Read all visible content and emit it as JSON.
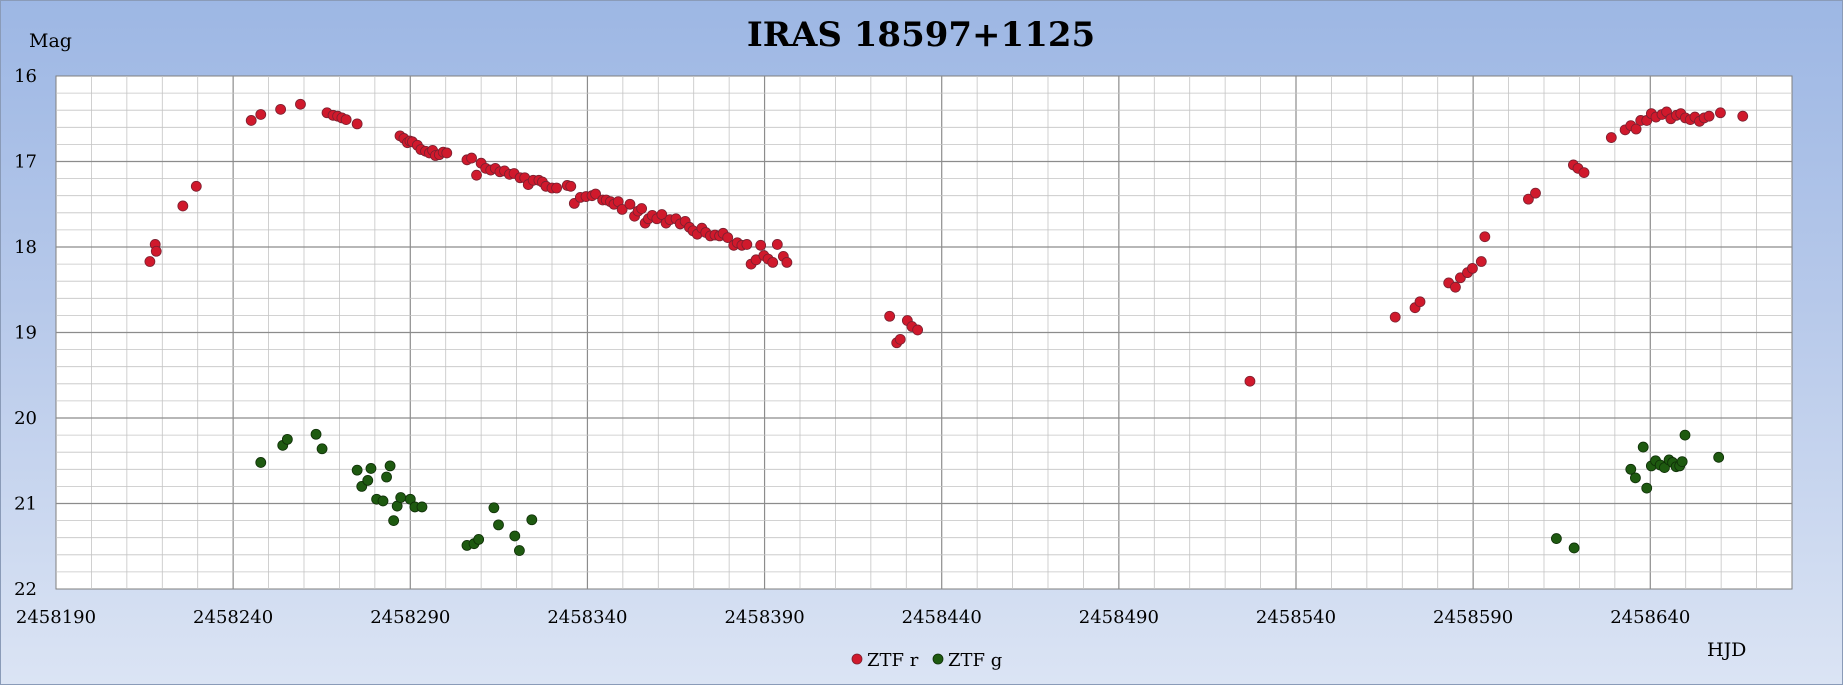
{
  "chart_data": {
    "type": "scatter",
    "title": "IRAS 18597+1125",
    "ylabel": "Mag",
    "xlabel": "HJD",
    "xlim": [
      2458190,
      2458680
    ],
    "ylim": [
      22,
      16
    ],
    "y_inverted": true,
    "x_ticks": [
      "2458190",
      "2458240",
      "2458290",
      "2458340",
      "2458390",
      "2458440",
      "2458490",
      "2458540",
      "2458590",
      "2458640"
    ],
    "x_tick_values": [
      2458190,
      2458240,
      2458290,
      2458340,
      2458390,
      2458440,
      2458490,
      2458540,
      2458590,
      2458640
    ],
    "y_ticks": [
      "16",
      "17",
      "18",
      "19",
      "20",
      "21",
      "22"
    ],
    "y_tick_values": [
      16,
      17,
      18,
      19,
      20,
      21,
      22
    ],
    "grid": true,
    "legend_position": "bottom-center",
    "series": [
      {
        "name": "ZTF r",
        "color": "#d0192c",
        "points": [
          [
            2458216.5,
            18.17
          ],
          [
            2458218.0,
            17.97
          ],
          [
            2458218.3,
            18.05
          ],
          [
            2458225.8,
            17.52
          ],
          [
            2458229.6,
            17.29
          ],
          [
            2458245.1,
            16.52
          ],
          [
            2458247.8,
            16.45
          ],
          [
            2458253.4,
            16.39
          ],
          [
            2458259.0,
            16.33
          ],
          [
            2458266.5,
            16.43
          ],
          [
            2458268.2,
            16.46
          ],
          [
            2458269.5,
            16.47
          ],
          [
            2458270.7,
            16.49
          ],
          [
            2458271.9,
            16.51
          ],
          [
            2458275.0,
            16.56
          ],
          [
            2458287.1,
            16.7
          ],
          [
            2458288.2,
            16.73
          ],
          [
            2458289.2,
            16.78
          ],
          [
            2458289.9,
            16.76
          ],
          [
            2458290.6,
            16.77
          ],
          [
            2458292.0,
            16.81
          ],
          [
            2458293.0,
            16.86
          ],
          [
            2458294.3,
            16.88
          ],
          [
            2458295.4,
            16.9
          ],
          [
            2458296.3,
            16.87
          ],
          [
            2458297.1,
            16.93
          ],
          [
            2458298.2,
            16.92
          ],
          [
            2458299.3,
            16.89
          ],
          [
            2458300.3,
            16.9
          ],
          [
            2458306.0,
            16.98
          ],
          [
            2458307.3,
            16.96
          ],
          [
            2458308.7,
            17.16
          ],
          [
            2458310.0,
            17.02
          ],
          [
            2458311.3,
            17.08
          ],
          [
            2458312.7,
            17.1
          ],
          [
            2458314.0,
            17.08
          ],
          [
            2458315.3,
            17.12
          ],
          [
            2458316.6,
            17.11
          ],
          [
            2458318.0,
            17.15
          ],
          [
            2458319.3,
            17.14
          ],
          [
            2458321.0,
            17.19
          ],
          [
            2458322.3,
            17.19
          ],
          [
            2458323.3,
            17.27
          ],
          [
            2458324.7,
            17.22
          ],
          [
            2458326.3,
            17.22
          ],
          [
            2458327.3,
            17.24
          ],
          [
            2458328.3,
            17.29
          ],
          [
            2458330.0,
            17.31
          ],
          [
            2458331.3,
            17.31
          ],
          [
            2458334.3,
            17.28
          ],
          [
            2458335.3,
            17.29
          ],
          [
            2458336.3,
            17.49
          ],
          [
            2458338.0,
            17.42
          ],
          [
            2458339.6,
            17.41
          ],
          [
            2458341.3,
            17.4
          ],
          [
            2458342.3,
            17.38
          ],
          [
            2458344.3,
            17.45
          ],
          [
            2458345.3,
            17.45
          ],
          [
            2458346.5,
            17.47
          ],
          [
            2458347.5,
            17.5
          ],
          [
            2458348.7,
            17.47
          ],
          [
            2458349.8,
            17.56
          ],
          [
            2458352.0,
            17.5
          ],
          [
            2458353.3,
            17.64
          ],
          [
            2458354.3,
            17.58
          ],
          [
            2458355.3,
            17.55
          ],
          [
            2458356.3,
            17.72
          ],
          [
            2458357.2,
            17.67
          ],
          [
            2458358.3,
            17.63
          ],
          [
            2458359.6,
            17.67
          ],
          [
            2458361.0,
            17.62
          ],
          [
            2458362.2,
            17.72
          ],
          [
            2458363.3,
            17.68
          ],
          [
            2458365.0,
            17.67
          ],
          [
            2458366.2,
            17.73
          ],
          [
            2458367.6,
            17.7
          ],
          [
            2458368.8,
            17.77
          ],
          [
            2458369.8,
            17.81
          ],
          [
            2458371.0,
            17.85
          ],
          [
            2458372.3,
            17.78
          ],
          [
            2458373.4,
            17.83
          ],
          [
            2458374.7,
            17.87
          ],
          [
            2458376.0,
            17.86
          ],
          [
            2458377.3,
            17.87
          ],
          [
            2458378.3,
            17.84
          ],
          [
            2458379.6,
            17.89
          ],
          [
            2458381.3,
            17.98
          ],
          [
            2458382.3,
            17.95
          ],
          [
            2458383.6,
            17.98
          ],
          [
            2458385.0,
            17.97
          ],
          [
            2458386.2,
            18.2
          ],
          [
            2458387.6,
            18.15
          ],
          [
            2458388.9,
            17.98
          ],
          [
            2458389.8,
            18.1
          ],
          [
            2458391.0,
            18.14
          ],
          [
            2458392.3,
            18.18
          ],
          [
            2458393.6,
            17.97
          ],
          [
            2458395.3,
            18.11
          ],
          [
            2458396.3,
            18.18
          ],
          [
            2458425.3,
            18.81
          ],
          [
            2458427.3,
            19.12
          ],
          [
            2458428.3,
            19.08
          ],
          [
            2458430.3,
            18.86
          ],
          [
            2458431.6,
            18.93
          ],
          [
            2458433.2,
            18.97
          ],
          [
            2458527.0,
            19.57
          ],
          [
            2458568.0,
            18.82
          ],
          [
            2458573.6,
            18.71
          ],
          [
            2458575.0,
            18.64
          ],
          [
            2458583.1,
            18.42
          ],
          [
            2458585.0,
            18.47
          ],
          [
            2458586.4,
            18.36
          ],
          [
            2458588.4,
            18.3
          ],
          [
            2458589.8,
            18.25
          ],
          [
            2458592.3,
            18.17
          ],
          [
            2458593.3,
            17.88
          ],
          [
            2458605.6,
            17.44
          ],
          [
            2458607.6,
            17.37
          ],
          [
            2458618.3,
            17.04
          ],
          [
            2458619.6,
            17.08
          ],
          [
            2458621.3,
            17.13
          ],
          [
            2458629.0,
            16.72
          ],
          [
            2458632.9,
            16.63
          ],
          [
            2458634.5,
            16.58
          ],
          [
            2458636.0,
            16.62
          ],
          [
            2458637.3,
            16.52
          ],
          [
            2458639.0,
            16.52
          ],
          [
            2458640.3,
            16.44
          ],
          [
            2458641.6,
            16.48
          ],
          [
            2458643.3,
            16.45
          ],
          [
            2458644.6,
            16.42
          ],
          [
            2458645.8,
            16.5
          ],
          [
            2458647.4,
            16.46
          ],
          [
            2458648.6,
            16.44
          ],
          [
            2458649.9,
            16.49
          ],
          [
            2458651.3,
            16.51
          ],
          [
            2458652.6,
            16.48
          ],
          [
            2458653.9,
            16.53
          ],
          [
            2458655.2,
            16.49
          ],
          [
            2458656.6,
            16.47
          ],
          [
            2458659.8,
            16.43
          ],
          [
            2458666.1,
            16.47
          ]
        ]
      },
      {
        "name": "ZTF g",
        "color": "#1e5a10",
        "points": [
          [
            2458247.8,
            20.52
          ],
          [
            2458254.0,
            20.32
          ],
          [
            2458255.3,
            20.25
          ],
          [
            2458263.4,
            20.19
          ],
          [
            2458265.1,
            20.36
          ],
          [
            2458275.0,
            20.61
          ],
          [
            2458276.3,
            20.8
          ],
          [
            2458278.0,
            20.73
          ],
          [
            2458278.9,
            20.59
          ],
          [
            2458280.5,
            20.95
          ],
          [
            2458282.3,
            20.97
          ],
          [
            2458283.3,
            20.69
          ],
          [
            2458284.3,
            20.56
          ],
          [
            2458285.3,
            21.2
          ],
          [
            2458286.3,
            21.03
          ],
          [
            2458287.3,
            20.93
          ],
          [
            2458290.0,
            20.95
          ],
          [
            2458291.3,
            21.04
          ],
          [
            2458293.3,
            21.04
          ],
          [
            2458306.0,
            21.49
          ],
          [
            2458308.0,
            21.47
          ],
          [
            2458309.3,
            21.42
          ],
          [
            2458313.6,
            21.05
          ],
          [
            2458314.9,
            21.25
          ],
          [
            2458319.5,
            21.38
          ],
          [
            2458320.8,
            21.55
          ],
          [
            2458324.3,
            21.19
          ],
          [
            2458613.5,
            21.41
          ],
          [
            2458618.5,
            21.52
          ],
          [
            2458634.5,
            20.6
          ],
          [
            2458635.8,
            20.7
          ],
          [
            2458638.0,
            20.34
          ],
          [
            2458639.0,
            20.82
          ],
          [
            2458640.3,
            20.56
          ],
          [
            2458641.5,
            20.5
          ],
          [
            2458642.8,
            20.55
          ],
          [
            2458644.0,
            20.58
          ],
          [
            2458645.3,
            20.49
          ],
          [
            2458646.3,
            20.52
          ],
          [
            2458647.3,
            20.57
          ],
          [
            2458648.3,
            20.56
          ],
          [
            2458649.0,
            20.51
          ],
          [
            2458649.8,
            20.2
          ],
          [
            2458659.3,
            20.46
          ]
        ]
      }
    ]
  }
}
